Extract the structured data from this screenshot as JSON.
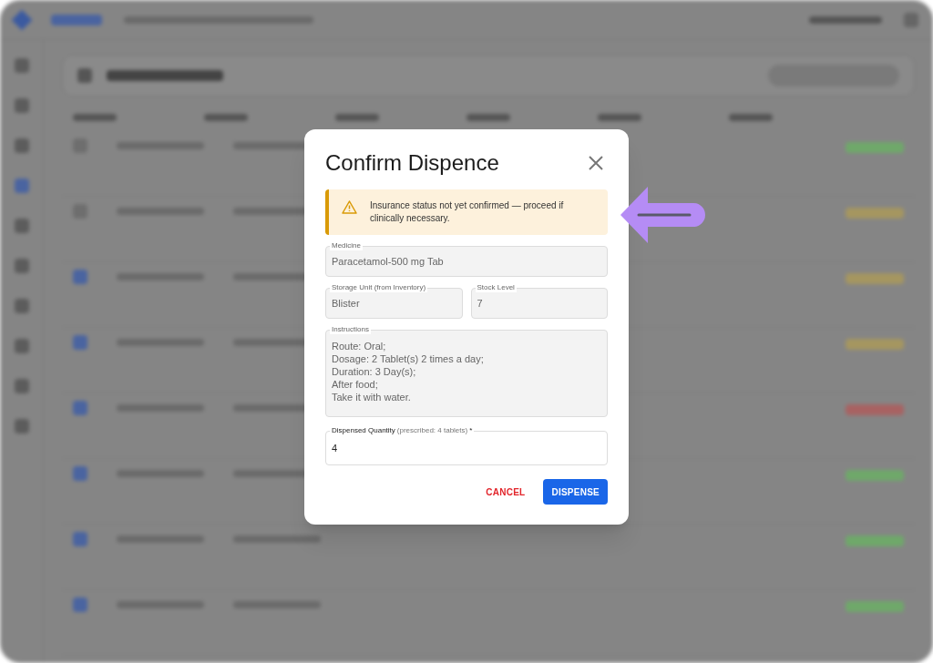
{
  "dialog": {
    "title": "Confirm Dispence",
    "alert": {
      "kind": "warning",
      "text": "Insurance status not yet confirmed — proceed if clinically necessary."
    },
    "rows": [
      {
        "fields": [
          {
            "label": "Medicine",
            "value": "Paracetamol-500 mg Tab",
            "disabled": true
          }
        ]
      },
      {
        "fields": [
          {
            "label": "Storage Unit (from Inventory)",
            "value": "Blister",
            "disabled": true
          },
          {
            "label": "Stock Level",
            "value": "7",
            "disabled": true
          }
        ]
      },
      {
        "fields": [
          {
            "label": "Instructions",
            "value": "Route: Oral;\nDosage: 2 Tablet(s) 2 times a day;\nDuration: 3 Day(s);\nAfter food;\nTake it with water.",
            "disabled": true
          }
        ]
      }
    ],
    "quantity": {
      "label": "Dispensed Quantity",
      "hint": "(prescribed: 4 tablets)",
      "required_mark": "*",
      "value": "4",
      "disabled": false
    },
    "buttons": [
      {
        "label": "CANCEL",
        "kind": "text"
      },
      {
        "label": "DISPENSE",
        "kind": "contained"
      }
    ]
  }
}
